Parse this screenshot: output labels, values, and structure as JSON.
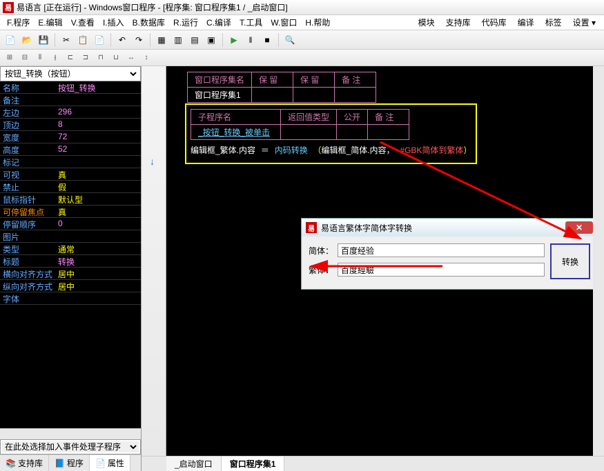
{
  "window_title": "易语言 [正在运行] - Windows窗口程序 - [程序集: 窗口程序集1 / _启动窗口]",
  "menu": [
    "F.程序",
    "E.编辑",
    "V.查看",
    "I.插入",
    "B.数据库",
    "R.运行",
    "C.编译",
    "T.工具",
    "W.窗口",
    "H.帮助"
  ],
  "menu_right": [
    "模块",
    "支持库",
    "代码库",
    "编译",
    "标签",
    "设置 ▾"
  ],
  "prop_selector": "按钮_转换（按钮）",
  "props": [
    {
      "label": "名称",
      "value": "按钮_转换",
      "vclass": "prop-value-pink"
    },
    {
      "label": "备注",
      "value": ""
    },
    {
      "label": "左边",
      "value": "296",
      "vclass": "prop-value-pink"
    },
    {
      "label": "顶边",
      "value": "8",
      "vclass": "prop-value-pink"
    },
    {
      "label": "宽度",
      "value": "72",
      "vclass": "prop-value-pink"
    },
    {
      "label": "高度",
      "value": "52",
      "vclass": "prop-value-pink"
    },
    {
      "label": "标记",
      "value": ""
    },
    {
      "label": "可视",
      "value": "真",
      "vclass": "prop-value-yellow"
    },
    {
      "label": "禁止",
      "value": "假",
      "vclass": "prop-value-yellow"
    },
    {
      "label": "鼠标指针",
      "value": "默认型",
      "vclass": "prop-value-yellow"
    },
    {
      "label": "可停留焦点",
      "value": "真",
      "vclass": "prop-value-yellow",
      "lclass": "prop-label-orange"
    },
    {
      "label": "  停留顺序",
      "value": "0",
      "vclass": "prop-value-pink"
    },
    {
      "label": "图片",
      "value": ""
    },
    {
      "label": "类型",
      "value": "通常",
      "vclass": "prop-value-yellow"
    },
    {
      "label": "标题",
      "value": "转换",
      "vclass": "prop-value-pink"
    },
    {
      "label": "横向对齐方式",
      "value": "居中",
      "vclass": "prop-value-yellow"
    },
    {
      "label": "纵向对齐方式",
      "value": "居中",
      "vclass": "prop-value-yellow"
    },
    {
      "label": "字体",
      "value": ""
    }
  ],
  "event_selector": "在此处选择加入事件处理子程序",
  "sidebar_tabs": [
    "支持库",
    "程序",
    "属性"
  ],
  "code_table1": {
    "headers": [
      "窗口程序集名",
      "保 留",
      "保 留",
      "备 注"
    ],
    "value": "窗口程序集1"
  },
  "code_table2": {
    "headers": [
      "子程序名",
      "返回值类型",
      "公开",
      "备 注"
    ],
    "subname": "_按钮_转换_被单击"
  },
  "codeline": {
    "var": "编辑框_繁体.内容",
    "eq": "＝",
    "fn": "内码转换",
    "arg1": "编辑框_简体.内容",
    "const": "#GBK简体到繁体"
  },
  "dialog": {
    "title": "易语言繁体字简体字转换",
    "label_simp": "简体：",
    "label_trad": "繁体：",
    "value_simp": "百度经验",
    "value_trad": "百度經驗",
    "btn": "转换"
  },
  "bottom_tabs": [
    "_启动窗口",
    "窗口程序集1"
  ]
}
